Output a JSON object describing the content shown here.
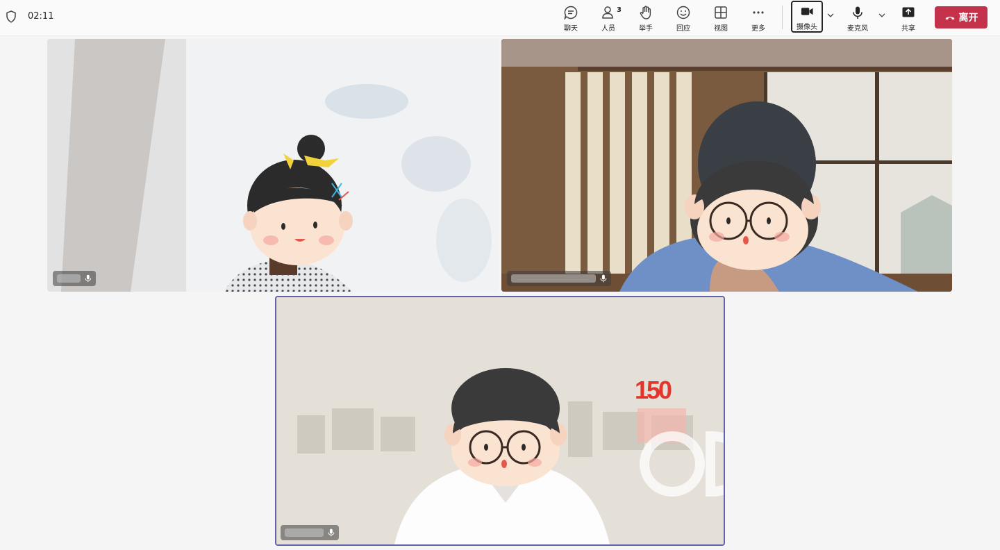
{
  "topbar": {
    "timer": "02:11",
    "buttons": {
      "chat": "聊天",
      "people": "人员",
      "people_count": "3",
      "raise_hand": "举手",
      "react": "回应",
      "view": "视图",
      "more": "更多",
      "camera": "摄像头",
      "mic": "麦克风",
      "share": "共享"
    },
    "leave_label": "离开"
  },
  "colors": {
    "leave_bg": "#c4314b",
    "active_speaker_border": "#6264a7",
    "logo_red": "#e2362c"
  },
  "tiles": [
    {
      "id": "participant-1",
      "active": false,
      "name_blurred": true
    },
    {
      "id": "participant-2",
      "active": false,
      "name_blurred": true
    },
    {
      "id": "participant-3",
      "active": true,
      "name_blurred": true,
      "background_logo": "150"
    }
  ],
  "icons": {
    "shield": "shield-icon",
    "chat": "chat-icon",
    "people": "people-icon",
    "hand": "hand-icon",
    "react": "smiley-icon",
    "view": "grid-icon",
    "more": "more-icon",
    "camera": "camera-icon",
    "mic": "mic-icon",
    "share": "share-icon",
    "leave": "phone-hangup-icon"
  }
}
